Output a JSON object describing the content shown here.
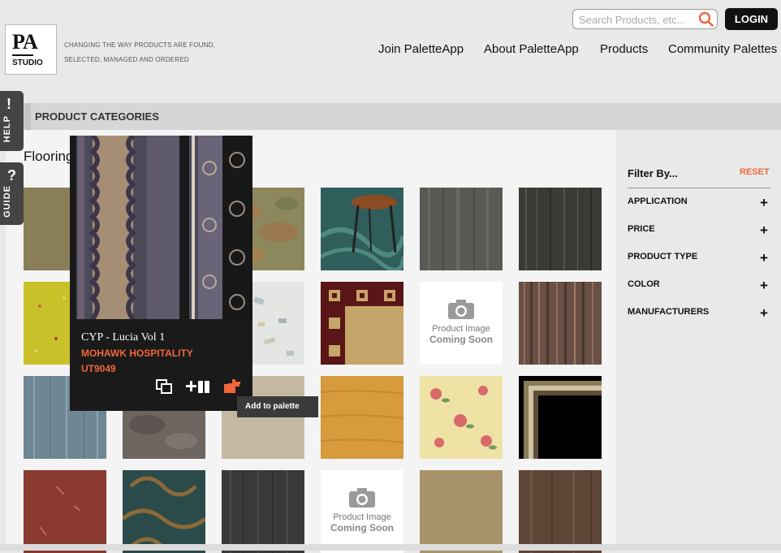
{
  "logo": {
    "mark": "PA",
    "studio": "STUDIO"
  },
  "tagline": [
    "CHANGING THE WAY PRODUCTS ARE FOUND,",
    "SELECTED, MANAGED AND ORDERED"
  ],
  "search": {
    "placeholder": "Search Products, etc...",
    "icon": "search-icon"
  },
  "login_label": "LOGIN",
  "nav": [
    "Join PaletteApp",
    "About PaletteApp",
    "Products",
    "Community Palettes"
  ],
  "side_tabs": {
    "help": "HELP",
    "guide": "GUIDE"
  },
  "categories_title": "PRODUCT CATEGORIES",
  "section_title": "Flooring",
  "placeholder_tile": {
    "line1": "Product Image",
    "line2": "Coming Soon"
  },
  "filter": {
    "title": "Filter By...",
    "reset": "RESET",
    "items": [
      "APPLICATION",
      "PRICE",
      "PRODUCT TYPE",
      "COLOR",
      "MANUFACTURERS"
    ],
    "expand_symbol": "+"
  },
  "popup": {
    "name": "CYP - Lucia Vol 1",
    "manufacturer": "MOHAWK HOSPITALITY",
    "code": "UT9049",
    "actions": [
      "view-icon",
      "compare-icon",
      "add-to-palette-icon"
    ],
    "tooltip": "Add to palette"
  },
  "colors": {
    "accent": "#f0663a",
    "dark": "#1a1a1a",
    "button": "#111111"
  }
}
